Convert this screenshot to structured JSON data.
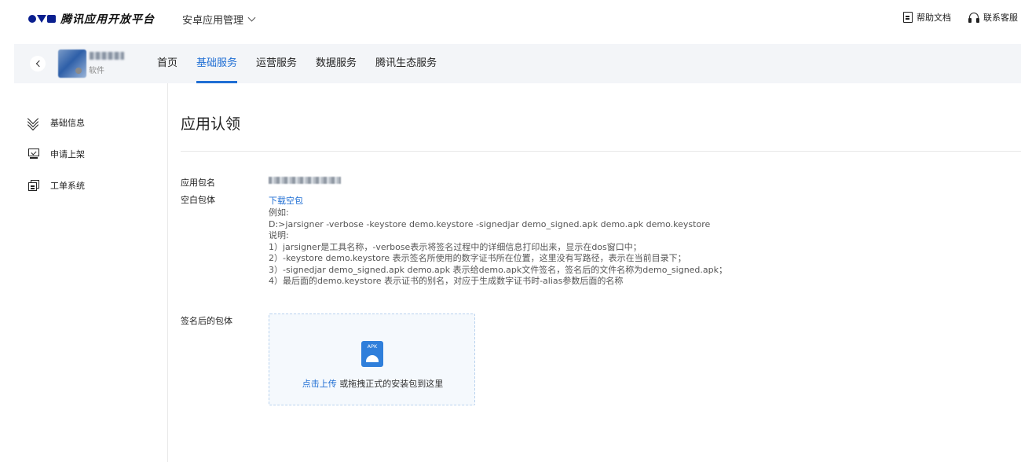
{
  "topbar": {
    "logo_text": "腾讯应用开放平台",
    "app_switch_label": "安卓应用管理",
    "help_doc_label": "帮助文档",
    "contact_label": "联系客服"
  },
  "nav": {
    "app_tag": "软件",
    "tabs": [
      {
        "label": "首页",
        "active": false
      },
      {
        "label": "基础服务",
        "active": true
      },
      {
        "label": "运营服务",
        "active": false
      },
      {
        "label": "数据服务",
        "active": false
      },
      {
        "label": "腾讯生态服务",
        "active": false
      }
    ]
  },
  "sidebar": {
    "items": [
      {
        "label": "基础信息",
        "icon": "layers-icon"
      },
      {
        "label": "申请上架",
        "icon": "monitor-icon"
      },
      {
        "label": "工单系统",
        "icon": "ticket-icon"
      }
    ]
  },
  "main": {
    "title": "应用认领",
    "package_name_label": "应用包名",
    "blank_package_label": "空白包体",
    "download_link": "下载空包",
    "description_lines": [
      "例如:",
      "D:>jarsigner -verbose -keystore demo.keystore -signedjar demo_signed.apk demo.apk demo.keystore",
      "说明:",
      "1）jarsigner是工具名称，-verbose表示将签名过程中的详细信息打印出来，显示在dos窗口中；",
      "2）-keystore demo.keystore 表示签名所使用的数字证书所在位置，这里没有写路径，表示在当前目录下；",
      "3）-signedjar demo_signed.apk demo.apk 表示给demo.apk文件签名，签名后的文件名称为demo_signed.apk；",
      "4）最后面的demo.keystore 表示证书的别名，对应于生成数字证书时-alias参数后面的名称"
    ],
    "signed_package_label": "签名后的包体",
    "upload": {
      "apk_icon_text": "APK",
      "click_text": "点击上传",
      "drag_text": " 或拖拽正式的安装包到这里"
    }
  },
  "colors": {
    "accent": "#1f6ed4",
    "brand": "#0a1f8f",
    "nav_bg": "#f3f5f8"
  }
}
